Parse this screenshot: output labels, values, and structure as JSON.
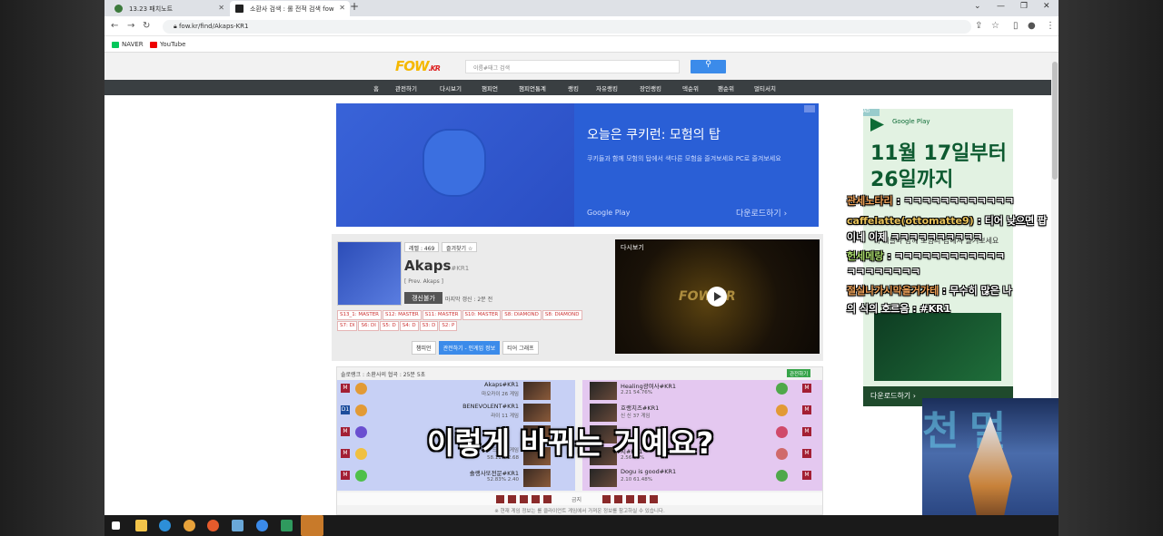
{
  "browser": {
    "tabs": [
      {
        "title": "13.23 패치노트",
        "active": false
      },
      {
        "title": "소환사 검색 : 롤 전적 검색 fow",
        "active": true
      }
    ],
    "url": "fow.kr/find/Akaps-KR1",
    "bookmarks": [
      "NAVER",
      "YouTube"
    ]
  },
  "site": {
    "logo": "FOW",
    "logo_suffix": ".KR",
    "search_placeholder": "이름#태그 검색",
    "menu": [
      "홈",
      "관전하기",
      "다시보기",
      "챔피언",
      "챔피언통계",
      "랭킹",
      "자유랭킹",
      "장인랭킹",
      "덱순위",
      "팬순위",
      "멀티서치"
    ]
  },
  "ad_top": {
    "title": "오늘은 쿠키런: 모험의 탑",
    "desc": "쿠키들과 함께 모험의 탑에서 색다른 모험을 즐겨보세요 PC로 즐겨보세요",
    "store": "Google Play",
    "download": "다운로드하기"
  },
  "profile": {
    "level": "레벨 : 469",
    "favorite": "즐겨찾기 ☆",
    "name": "Akaps",
    "tag": "#KR1",
    "prev": "[ Prev. Akaps ]",
    "renew": "갱신불가",
    "last_update": "마지막 갱신 : 2분 전",
    "seasons": [
      "S13_1: MASTER",
      "S12: MASTER",
      "S11: MASTER",
      "S10: MASTER",
      "S8: DIAMOND",
      "S8: DIAMOND",
      "S7: DI",
      "S6: DI",
      "S5: D",
      "S4: D",
      "S3: D",
      "S2: P"
    ],
    "tabs": [
      "챔피언",
      "관전하기 - 인게임 정보",
      "티어 그래프"
    ]
  },
  "video": {
    "label": "다시보기",
    "logo": "FOW.KR"
  },
  "game": {
    "header": "솔로랭크 : 소환사의 협곡 : 25분 5초",
    "flag": "관전하기",
    "blue": [
      {
        "rank": "M",
        "name": "Akaps#KR1",
        "stat1": "마오카이 26 게임",
        "stat2": "61.53%  1.92"
      },
      {
        "rank": "D1",
        "name": "BENEVOLENT#KR1",
        "stat1": "라이 11 게임",
        "stat2": "53.33%  1.87"
      },
      {
        "rank": "M",
        "name": "",
        "stat1": "",
        "stat2": ""
      },
      {
        "rank": "M",
        "name": "",
        "stat1": "드 234 게임",
        "stat2": "58.11%  2.68"
      },
      {
        "rank": "M",
        "name": "솔랭사또전문#KR1",
        "stat1": "마도스 53 게임",
        "stat2": "52.83%  2.40"
      }
    ],
    "red": [
      {
        "rank": "M",
        "name": "Healing광여사#KR1",
        "stat1": "럭스 84 게임",
        "stat2": "2.21  54.76%"
      },
      {
        "rank": "M",
        "name": "호랭치즈#KR1",
        "stat1": "신 신 37 게임",
        "stat2": "1.79  56.76%"
      },
      {
        "rank": "M",
        "name": "",
        "stat1": "",
        "stat2": ""
      },
      {
        "rank": "M",
        "name": "치#KR1",
        "stat1": "2 게임",
        "stat2": "2.56  60%"
      },
      {
        "rank": "M",
        "name": "Dogu is good#KR1",
        "stat1": "미오가이 135 게임",
        "stat2": "2.10  61.48%"
      }
    ],
    "bans_label": "금지",
    "footer": "※ 현재 게임 정보는 롤 클라이언트 게임에서 가져온 정보를 참고하실 수 있습니다."
  },
  "ad_right": {
    "close": "AD",
    "store": "Google Play",
    "date": "11월 17일부터 26일까지",
    "sub": "쿠키들과 함께 모험의 탑에서 즐겨보세요",
    "download": "다운로드하기"
  },
  "chat": [
    {
      "user": "관세노타리",
      "text": "ㅋㅋㅋㅋㅋㅋㅋㅋㅋㅋㅋㅋ"
    },
    {
      "user": "caffelatte(ottomatte9)",
      "text": "티어 낮으면 팝"
    },
    {
      "user": "",
      "text": "이네 이제 ㅋㅋㅋㅋㅋㅋㅋㅋㅋㅋ"
    },
    {
      "user": "헌세메랑",
      "text": "ㅋㅋㅋㅋㅋㅋㅋㅋㅋㅋㅋㅋ"
    },
    {
      "user": "",
      "text": "ㅋㅋㅋㅋㅋㅋㅋㅋ"
    },
    {
      "user": "절실나가시막을거가테",
      "text": "무수히 많은 나"
    },
    {
      "user": "",
      "text": "의 식의 호르음 : #KR1"
    }
  ],
  "subtitle": "이렇게 바뀌는 거예요?",
  "webcam_text": "천 멀"
}
